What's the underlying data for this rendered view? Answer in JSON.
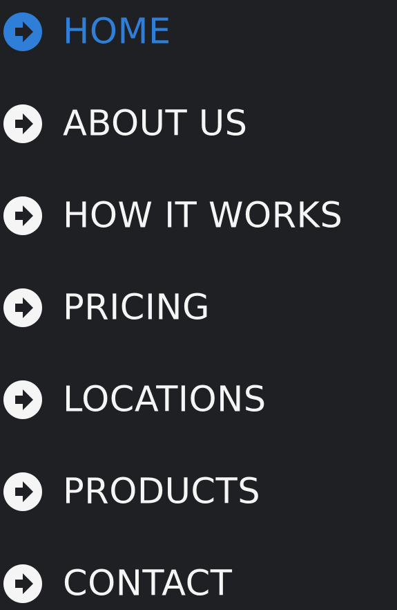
{
  "nav": {
    "items": [
      {
        "label": "HOME",
        "active": true
      },
      {
        "label": "ABOUT US",
        "active": false
      },
      {
        "label": "HOW IT WORKS",
        "active": false
      },
      {
        "label": "PRICING",
        "active": false
      },
      {
        "label": "LOCATIONS",
        "active": false
      },
      {
        "label": "PRODUCTS",
        "active": false
      },
      {
        "label": "CONTACT",
        "active": false
      }
    ],
    "icon": "arrow-circle-right-icon"
  },
  "colors": {
    "background": "#1e2023",
    "text": "#f5f5f5",
    "active": "#2f7fd8"
  }
}
